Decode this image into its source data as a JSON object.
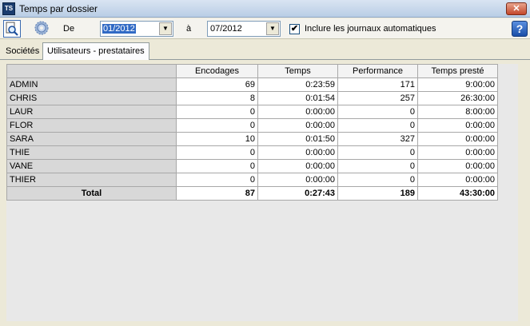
{
  "window": {
    "title": "Temps par dossier",
    "icon_text": "TS",
    "close_label": "✕"
  },
  "toolbar": {
    "from_label": "De",
    "from_value": "01/2012",
    "to_label": "à",
    "to_value": "07/2012",
    "include_auto_label": "Inclure les journaux automatiques",
    "include_auto_checked": true,
    "check_mark": "✔",
    "help_label": "?"
  },
  "tabs": [
    {
      "label": "Sociétés",
      "active": false
    },
    {
      "label": "Utilisateurs - prestataires",
      "active": true
    }
  ],
  "table": {
    "columns": [
      "Encodages",
      "Temps",
      "Performance",
      "Temps presté"
    ],
    "rows": [
      {
        "name": "ADMIN",
        "encodages": "69",
        "temps": "0:23:59",
        "performance": "171",
        "temps_preste": "9:00:00"
      },
      {
        "name": "CHRIS",
        "encodages": "8",
        "temps": "0:01:54",
        "performance": "257",
        "temps_preste": "26:30:00"
      },
      {
        "name": "LAUR",
        "encodages": "0",
        "temps": "0:00:00",
        "performance": "0",
        "temps_preste": "8:00:00"
      },
      {
        "name": "FLOR",
        "encodages": "0",
        "temps": "0:00:00",
        "performance": "0",
        "temps_preste": "0:00:00"
      },
      {
        "name": "SARA",
        "encodages": "10",
        "temps": "0:01:50",
        "performance": "327",
        "temps_preste": "0:00:00"
      },
      {
        "name": "THIE",
        "encodages": "0",
        "temps": "0:00:00",
        "performance": "0",
        "temps_preste": "0:00:00"
      },
      {
        "name": "VANE",
        "encodages": "0",
        "temps": "0:00:00",
        "performance": "0",
        "temps_preste": "0:00:00"
      },
      {
        "name": "THIER",
        "encodages": "0",
        "temps": "0:00:00",
        "performance": "0",
        "temps_preste": "0:00:00"
      }
    ],
    "total": {
      "name": "Total",
      "encodages": "87",
      "temps": "0:27:43",
      "performance": "189",
      "temps_preste": "43:30:00"
    }
  }
}
